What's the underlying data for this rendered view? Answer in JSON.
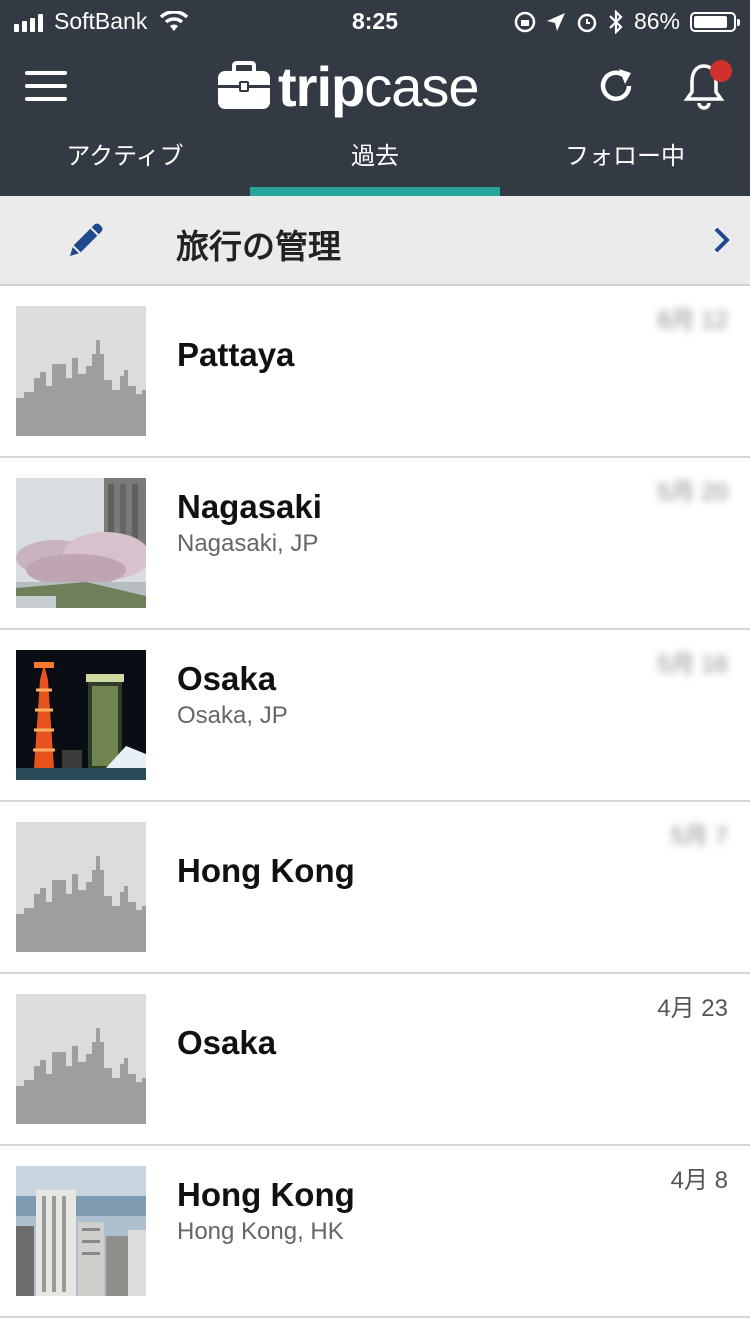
{
  "status_bar": {
    "carrier": "SoftBank",
    "time": "8:25",
    "battery_percent": "86%",
    "battery_level": 0.86
  },
  "app": {
    "logo_part1": "trip",
    "logo_part2": "case"
  },
  "tabs": [
    {
      "label": "アクティブ",
      "active": false
    },
    {
      "label": "過去",
      "active": true
    },
    {
      "label": "フォロー中",
      "active": false
    }
  ],
  "manage": {
    "label": "旅行の管理"
  },
  "trips": [
    {
      "title": "Pattaya",
      "subtitle": "",
      "date": "8月 12",
      "date_blurred": true,
      "thumb": "placeholder-skyline"
    },
    {
      "title": "Nagasaki",
      "subtitle": "Nagasaki, JP",
      "date": "5月 20",
      "date_blurred": true,
      "thumb": "cherry-blossoms-photo"
    },
    {
      "title": "Osaka",
      "subtitle": "Osaka, JP",
      "date": "5月 16",
      "date_blurred": true,
      "thumb": "port-tower-night-photo"
    },
    {
      "title": "Hong Kong",
      "subtitle": "",
      "date": "5月 7",
      "date_blurred": true,
      "thumb": "placeholder-skyline"
    },
    {
      "title": "Osaka",
      "subtitle": "",
      "date": "4月 23",
      "date_blurred": false,
      "thumb": "placeholder-skyline"
    },
    {
      "title": "Hong Kong",
      "subtitle": "Hong Kong, HK",
      "date": "4月 8",
      "date_blurred": false,
      "thumb": "city-harbor-photo"
    }
  ],
  "colors": {
    "header_bg": "#333a44",
    "tab_indicator": "#26a69a",
    "badge": "#d0312d",
    "accent_blue": "#1e4a8c"
  }
}
